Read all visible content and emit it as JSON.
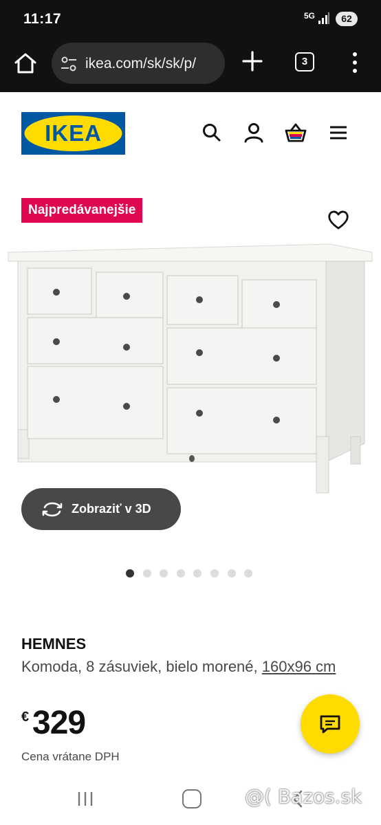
{
  "status_bar": {
    "time": "11:17",
    "network": "5G",
    "battery": "62"
  },
  "browser": {
    "url": "ikea.com/sk/sk/p/",
    "tab_count": "3",
    "home_icon": "home-icon",
    "tune_icon": "tune-icon",
    "new_tab_icon": "plus-icon",
    "menu_icon": "more-vert-icon"
  },
  "site_header": {
    "logo_text": "IKEA",
    "logo_colors": {
      "blue": "#0058a3",
      "yellow": "#ffdb00"
    },
    "icons": [
      "search-icon",
      "account-icon",
      "cart-icon",
      "hamburger-menu-icon"
    ]
  },
  "product_image": {
    "badge": "Najpredávanejšie",
    "badge_color": "#e00751",
    "view_3d_label": "Zobraziť v 3D",
    "carousel_count": 8,
    "carousel_active_index": 0
  },
  "product": {
    "name": "HEMNES",
    "description": "Komoda, 8 zásuviek, bielo morené,",
    "dimensions": "160x96 cm",
    "currency": "€",
    "price": "329",
    "price_note": "Cena vrátane DPH"
  },
  "chat": {
    "icon": "chat-icon",
    "color": "#ffdb00"
  },
  "watermark": "@( Bazos.sk"
}
